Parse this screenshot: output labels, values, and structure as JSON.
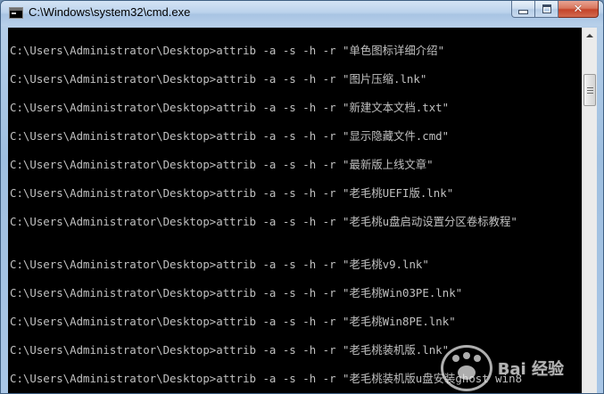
{
  "window": {
    "title": "C:\\Windows\\system32\\cmd.exe",
    "icon": "console-icon"
  },
  "caption_buttons": {
    "minimize_icon": "minimize-icon",
    "maximize_icon": "maximize-icon",
    "close_icon": "close-icon",
    "close_glyph": "✕"
  },
  "console": {
    "text_color": "#c0c0c0",
    "background": "#000000",
    "lines": [
      "C:\\Users\\Administrator\\Desktop>attrib -a -s -h -r \"单色图标详细介绍\"",
      "C:\\Users\\Administrator\\Desktop>attrib -a -s -h -r \"图片压缩.lnk\"",
      "C:\\Users\\Administrator\\Desktop>attrib -a -s -h -r \"新建文本文档.txt\"",
      "C:\\Users\\Administrator\\Desktop>attrib -a -s -h -r \"显示隐藏文件.cmd\"",
      "C:\\Users\\Administrator\\Desktop>attrib -a -s -h -r \"最新版上线文章\"",
      "C:\\Users\\Administrator\\Desktop>attrib -a -s -h -r \"老毛桃UEFI版.lnk\"",
      "C:\\Users\\Administrator\\Desktop>attrib -a -s -h -r \"老毛桃u盘启动设置分区卷标教程\"",
      "C:\\Users\\Administrator\\Desktop>attrib -a -s -h -r \"老毛桃v9.lnk\"",
      "C:\\Users\\Administrator\\Desktop>attrib -a -s -h -r \"老毛桃Win03PE.lnk\"",
      "C:\\Users\\Administrator\\Desktop>attrib -a -s -h -r \"老毛桃Win8PE.lnk\"",
      "C:\\Users\\Administrator\\Desktop>attrib -a -s -h -r \"老毛桃装机版.lnk\"",
      "C:\\Users\\Administrator\\Desktop>attrib -a -s -h -r \"老毛桃装机版u盘安装ghost win8"
    ]
  },
  "watermark": {
    "text": "Bai 经验"
  }
}
